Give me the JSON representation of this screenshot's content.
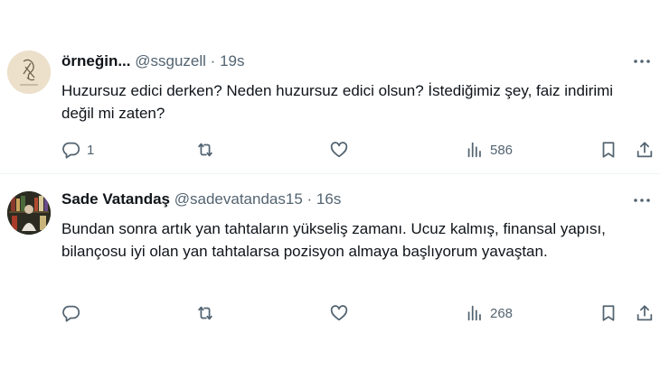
{
  "tweets": [
    {
      "display_name": "örneğin...",
      "handle": "@ssguzell",
      "separator": "·",
      "time": "19s",
      "text": "Huzursuz edici derken? Neden huzursuz edici olsun? İstediğimiz şey, faiz indirimi değil mi zaten?",
      "reply_count": "1",
      "views": "586",
      "avatar_icon": "sketch-avatar-icon"
    },
    {
      "display_name": "Sade Vatandaş",
      "handle": "@sadevatandas15",
      "separator": "·",
      "time": "16s",
      "text": "Bundan sonra artık yan tahtaların yükseliş zamanı. Ucuz kalmış, finansal yapısı, bilançosu iyi olan yan tahtalarsa pozisyon almaya başlıyorum yavaştan.",
      "reply_count": "",
      "views": "268",
      "avatar_icon": "bookshelf-avatar-icon"
    }
  ],
  "colors": {
    "text_primary": "#0f1419",
    "text_secondary": "#536471",
    "divider": "#eff3f4"
  }
}
